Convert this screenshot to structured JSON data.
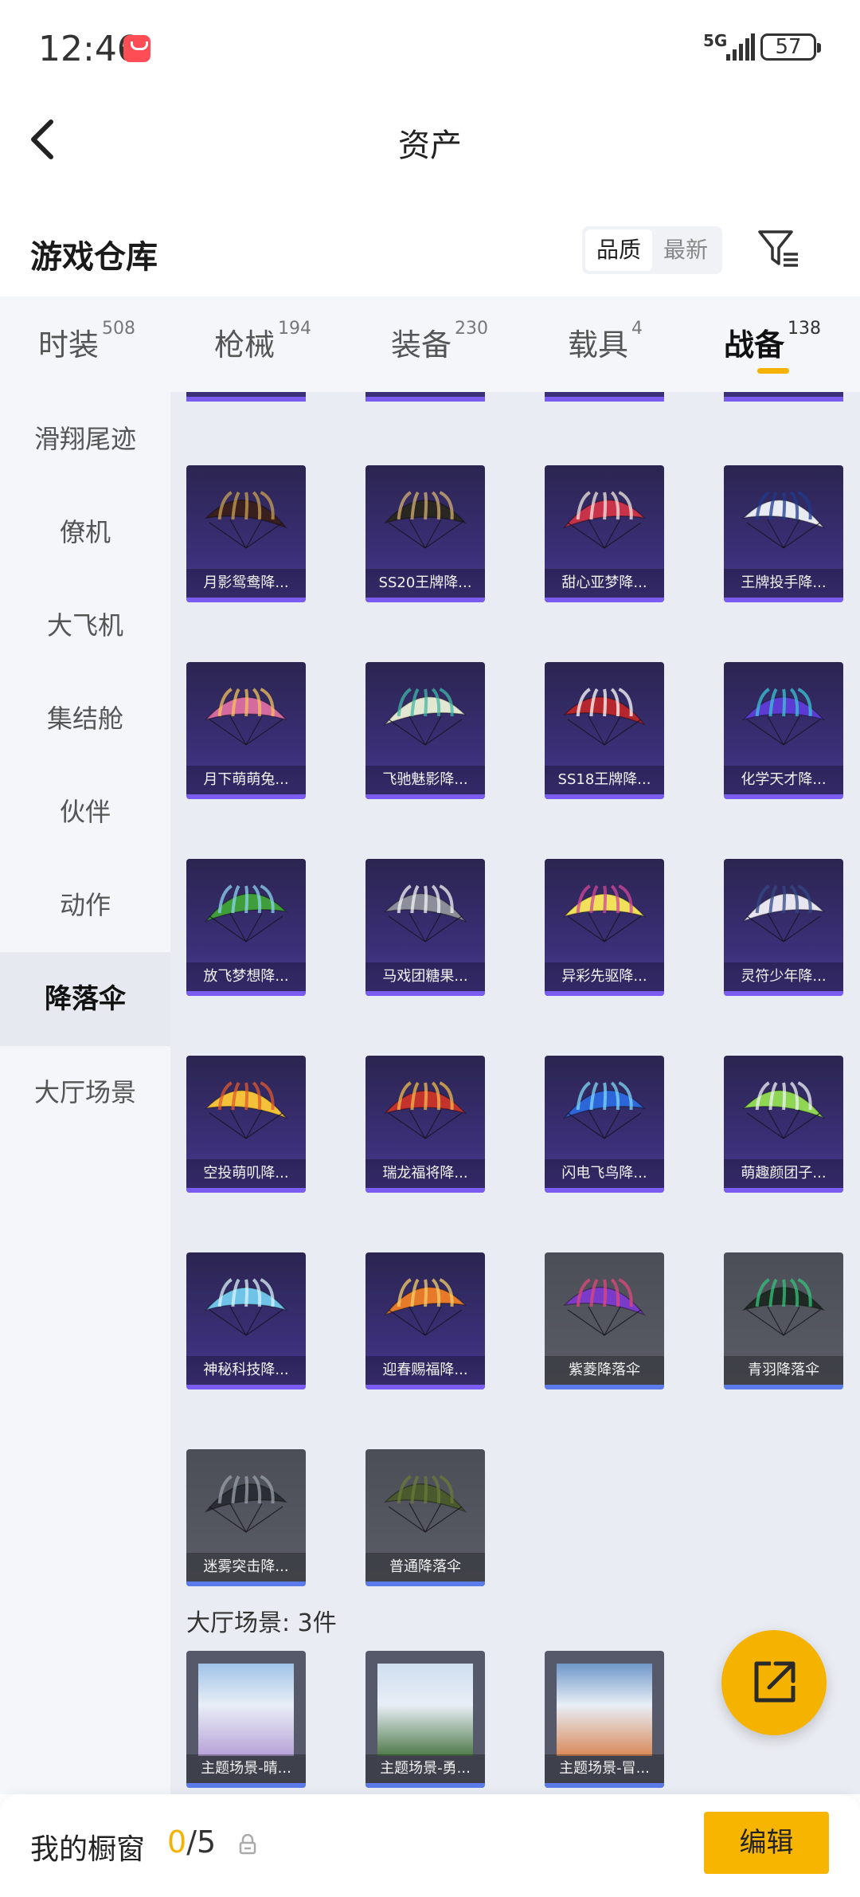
{
  "status_bar": {
    "time": "12:46",
    "network": "5G",
    "battery": "57"
  },
  "header": {
    "title": "资产"
  },
  "section": {
    "title": "游戏仓库",
    "sort_options": [
      "品质",
      "最新"
    ],
    "active_sort": "品质"
  },
  "tabs": [
    {
      "label": "时装",
      "count": "508"
    },
    {
      "label": "枪械",
      "count": "194"
    },
    {
      "label": "装备",
      "count": "230"
    },
    {
      "label": "载具",
      "count": "4"
    },
    {
      "label": "战备",
      "count": "138"
    }
  ],
  "active_tab": "战备",
  "sidebar": {
    "items": [
      "滑翔尾迹",
      "僚机",
      "大飞机",
      "集结舱",
      "伙伴",
      "动作",
      "降落伞",
      "大厅场景"
    ],
    "active": "降落伞"
  },
  "parachutes": [
    {
      "name": "月影鸳鸯降...",
      "style": "purple",
      "color": "#3a1f1f",
      "accent": "#c9a050"
    },
    {
      "name": "SS20王牌降...",
      "style": "purple",
      "color": "#2a2622",
      "accent": "#d4b070"
    },
    {
      "name": "甜心亚梦降...",
      "style": "purple",
      "color": "#c8334a",
      "accent": "#f1e7e0"
    },
    {
      "name": "王牌投手降...",
      "style": "purple",
      "color": "#e8ebf2",
      "accent": "#1f3b8f"
    },
    {
      "name": "月下萌萌兔...",
      "style": "purple",
      "color": "#d56aa0",
      "accent": "#f3c35a"
    },
    {
      "name": "飞驰魅影降...",
      "style": "purple",
      "color": "#e3e6d0",
      "accent": "#3fb7a5"
    },
    {
      "name": "SS18王牌降...",
      "style": "purple",
      "color": "#b5262e",
      "accent": "#ffffff"
    },
    {
      "name": "化学天才降...",
      "style": "purple",
      "color": "#5b3bd1",
      "accent": "#39c6d6"
    },
    {
      "name": "放飞梦想降...",
      "style": "purple",
      "color": "#3f9e3a",
      "accent": "#8bd3f2"
    },
    {
      "name": "马戏团糖果...",
      "style": "purple",
      "color": "#8c8f99",
      "accent": "#f4f4f6"
    },
    {
      "name": "异彩先驱降...",
      "style": "purple",
      "color": "#f0e05a",
      "accent": "#d2479a"
    },
    {
      "name": "灵符少年降...",
      "style": "purple",
      "color": "#e8e4f0",
      "accent": "#324a86"
    },
    {
      "name": "空投萌叽降...",
      "style": "purple",
      "color": "#f3c23a",
      "accent": "#e0582e"
    },
    {
      "name": "瑞龙福将降...",
      "style": "purple",
      "color": "#c4322e",
      "accent": "#f0b94a"
    },
    {
      "name": "闪电飞鸟降...",
      "style": "purple",
      "color": "#2d66d8",
      "accent": "#7fd8f5"
    },
    {
      "name": "萌趣颜团子...",
      "style": "purple",
      "color": "#8ed654",
      "accent": "#eef2f5"
    },
    {
      "name": "神秘科技降...",
      "style": "purple",
      "color": "#6fc3e6",
      "accent": "#d9f3fb"
    },
    {
      "name": "迎春赐福降...",
      "style": "purple",
      "color": "#e67a2a",
      "accent": "#f4d06a"
    },
    {
      "name": "紫菱降落伞",
      "style": "gray",
      "color": "#7a3bc8",
      "accent": "#e0477a"
    },
    {
      "name": "青羽降落伞",
      "style": "gray",
      "color": "#1f2a24",
      "accent": "#34c37a"
    },
    {
      "name": "迷雾突击降...",
      "style": "gray",
      "color": "#2a2d33",
      "accent": "#9aa0aa"
    },
    {
      "name": "普通降落伞",
      "style": "gray",
      "color": "#4a5a2c",
      "accent": "#6b7a3a"
    }
  ],
  "hall_scene_section": {
    "label": "大厅场景: 3件"
  },
  "hall_scenes": [
    {
      "name": "主题场景-晴...",
      "sky": "#9fc3e8",
      "ground": "#b7a2d8"
    },
    {
      "name": "主题场景-勇...",
      "sky": "#cfdff0",
      "ground": "#4f7a4a"
    },
    {
      "name": "主题场景-冒...",
      "sky": "#6f97c8",
      "ground": "#d98a5a"
    }
  ],
  "bottom_bar": {
    "label": "我的橱窗",
    "count_current": "0",
    "count_total": "/5",
    "edit_label": "编辑"
  }
}
